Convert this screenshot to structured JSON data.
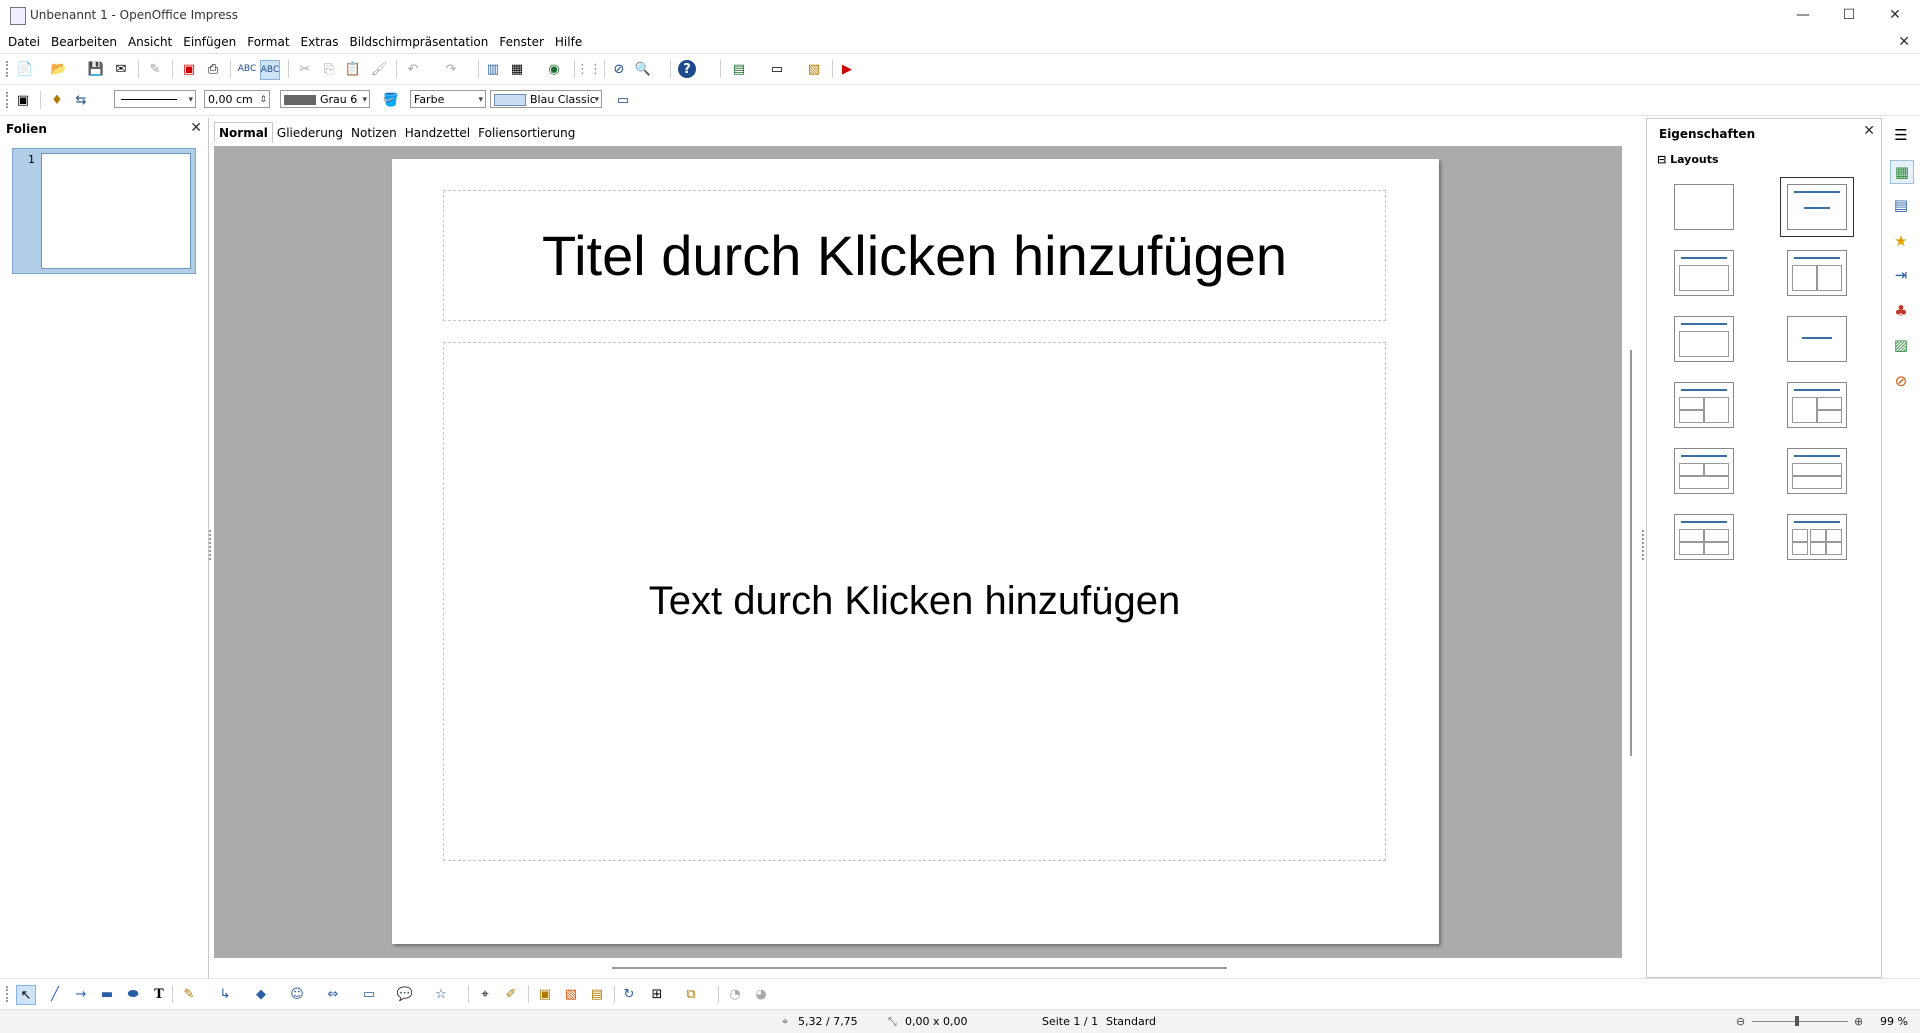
{
  "window": {
    "title": "Unbenannt 1 - OpenOffice Impress",
    "minimize": "—",
    "maximize": "☐",
    "close": "✕"
  },
  "menu": [
    "Datei",
    "Bearbeiten",
    "Ansicht",
    "Einfügen",
    "Format",
    "Extras",
    "Bildschirmpräsentation",
    "Fenster",
    "Hilfe"
  ],
  "menu_close": "✕",
  "format_toolbar": {
    "line_width": "0,00 cm",
    "line_color": "Grau 6",
    "area_style": "Farbe",
    "area_color": "Blau Classic"
  },
  "left_pane": {
    "title": "Folien",
    "close": "✕",
    "slide_number": "1"
  },
  "view_tabs": [
    "Normal",
    "Gliederung",
    "Notizen",
    "Handzettel",
    "Foliensortierung"
  ],
  "active_view": "Normal",
  "slide": {
    "title_placeholder": "Titel durch Klicken hinzufügen",
    "text_placeholder": "Text durch Klicken hinzufügen"
  },
  "properties": {
    "title": "Eigenschaften",
    "close": "✕",
    "section": "Layouts",
    "collapse": "⊟"
  },
  "status": {
    "position": "5,32 / 7,75",
    "size": "0,00 x 0,00",
    "page": "Seite 1 / 1",
    "master": "Standard",
    "zoom": "99 %"
  },
  "colors": {
    "accent_blue": "#3b6ea5",
    "workspace": "#ababab",
    "selection": "#b2cde6"
  }
}
